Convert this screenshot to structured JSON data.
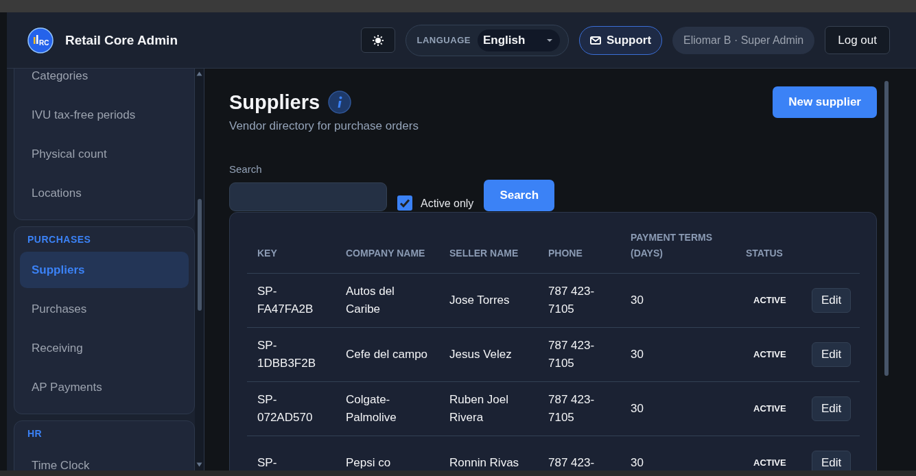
{
  "header": {
    "logo_text": "RC",
    "title": "Retail Core Admin",
    "language_label": "LANGUAGE",
    "language_value": "English",
    "support_label": "Support",
    "user": "Eliomar B · Super Admin",
    "logout_label": "Log out"
  },
  "sidebar": {
    "sections": [
      {
        "items": [
          {
            "label": "Categories",
            "selected": false
          },
          {
            "label": "IVU tax-free periods",
            "selected": false
          },
          {
            "label": "Physical count",
            "selected": false
          },
          {
            "label": "Locations",
            "selected": false
          }
        ]
      },
      {
        "title": "PURCHASES",
        "items": [
          {
            "label": "Suppliers",
            "selected": true
          },
          {
            "label": "Purchases",
            "selected": false
          },
          {
            "label": "Receiving",
            "selected": false
          },
          {
            "label": "AP Payments",
            "selected": false
          }
        ]
      },
      {
        "title": "HR",
        "items": [
          {
            "label": "Time Clock",
            "selected": false
          }
        ]
      }
    ]
  },
  "page": {
    "title": "Suppliers",
    "subtitle": "Vendor directory for purchase orders",
    "new_button": "New supplier",
    "search_label": "Search",
    "active_only": {
      "label": "Active only",
      "checked": true
    },
    "search_button": "Search"
  },
  "table": {
    "columns": [
      "KEY",
      "COMPANY NAME",
      "SELLER NAME",
      "PHONE",
      "PAYMENT TERMS (DAYS)",
      "STATUS"
    ],
    "rows": [
      {
        "key": "SP-FA47FA2B",
        "company": "Autos del Caribe",
        "seller": "Jose Torres",
        "phone": "787 423-7105",
        "terms": "30",
        "status": "ACTIVE",
        "action": "Edit"
      },
      {
        "key": "SP-1DBB3F2B",
        "company": "Cefe del campo",
        "seller": "Jesus Velez",
        "phone": "787 423-7105",
        "terms": "30",
        "status": "ACTIVE",
        "action": "Edit"
      },
      {
        "key": "SP-072AD570",
        "company": "Colgate-Palmolive",
        "seller": "Ruben Joel Rivera",
        "phone": "787 423-7105",
        "terms": "30",
        "status": "ACTIVE",
        "action": "Edit"
      },
      {
        "key": "SP-",
        "company": "Pepsi co",
        "seller": "Ronnin Rivas",
        "phone": "787 423-",
        "terms": "30",
        "status": "ACTIVE",
        "action": "Edit"
      }
    ]
  }
}
